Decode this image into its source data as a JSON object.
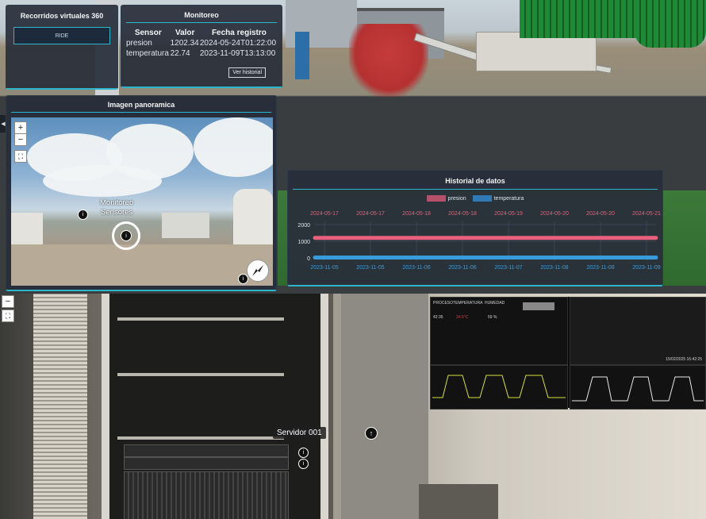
{
  "tour_panel": {
    "title": "Recorridos virtuales 360",
    "ride_button": "RIDE"
  },
  "monitor_panel": {
    "title": "Monitoreo",
    "headers": [
      "Sensor",
      "Valor",
      "Fecha registro"
    ],
    "rows": [
      {
        "sensor": "presion",
        "valor": "1202.34",
        "fecha": "2024-05-24T01:22:00"
      },
      {
        "sensor": "temperatura",
        "valor": "22.74",
        "fecha": "2023-11-09T13:13:00"
      }
    ],
    "history_button": "Ver historial"
  },
  "pano_panel": {
    "title": "Imagen panoramica",
    "zoom_in": "+",
    "zoom_out": "−",
    "hotspot_label_line1": "Monitoreo",
    "hotspot_label_line2": "Sensores",
    "hotspot_glyph": "i"
  },
  "history_panel": {
    "title": "Historial de datos",
    "series_colors": {
      "presion": "#e8607a",
      "temperatura": "#3a9bdc"
    }
  },
  "chart_data": {
    "type": "line",
    "title": "Historial de datos",
    "top_x_labels": [
      "2024-05-17",
      "2024-05-17",
      "2024-05-18",
      "2024-05-18",
      "2024-05-19",
      "2024-05-20",
      "2024-05-20",
      "2024-05-21"
    ],
    "bottom_x_labels": [
      "2023-11-05",
      "2023-11-05",
      "2023-11-06",
      "2023-11-06",
      "2023-11-07",
      "2023-11-08",
      "2023-11-08",
      "2023-11-09"
    ],
    "y_ticks": [
      "2000",
      "1000",
      "0"
    ],
    "ylim": [
      0,
      2000
    ],
    "series": [
      {
        "name": "presion",
        "values": [
          1202,
          1202,
          1202,
          1202,
          1202,
          1202,
          1202,
          1202
        ]
      },
      {
        "name": "temperatura",
        "values": [
          22,
          22,
          22,
          22,
          22,
          22,
          22,
          22
        ]
      }
    ],
    "grid": true,
    "legend": "top-center"
  },
  "bottom_view": {
    "server_label": "Servidor 001",
    "zoom_out": "−",
    "tv_date": "15/02/2025 16:42:25",
    "tv_headers": [
      "PROCESO",
      "TEMPERATURA",
      "HUMEDAD"
    ],
    "tv_values": [
      "42:35",
      "24.5°C",
      "59 %"
    ]
  }
}
